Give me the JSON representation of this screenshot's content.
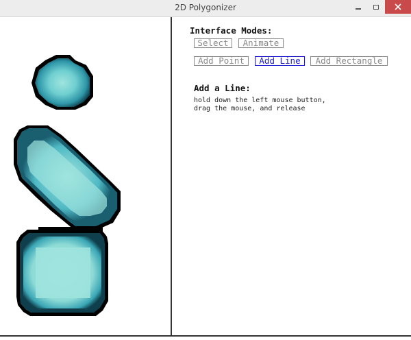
{
  "window": {
    "title": "2D Polygonizer"
  },
  "panel": {
    "modes_heading": "Interface Modes:",
    "buttons": {
      "select": "Select",
      "animate": "Animate",
      "add_point": "Add Point",
      "add_line": "Add Line",
      "add_rectangle": "Add Rectangle"
    },
    "active_mode": "Add Line",
    "instructions_heading": "Add a Line:",
    "instructions": [
      "hold down the left mouse button,",
      "drag the mouse, and release"
    ]
  },
  "colors": {
    "shape_outline": "#000000",
    "shape_edge": "#0f3f4c",
    "shape_mid": "#38aab8",
    "shape_core": "#a0e4de",
    "active_button": "#1a1acc",
    "inactive_button": "#8a8a8a"
  }
}
